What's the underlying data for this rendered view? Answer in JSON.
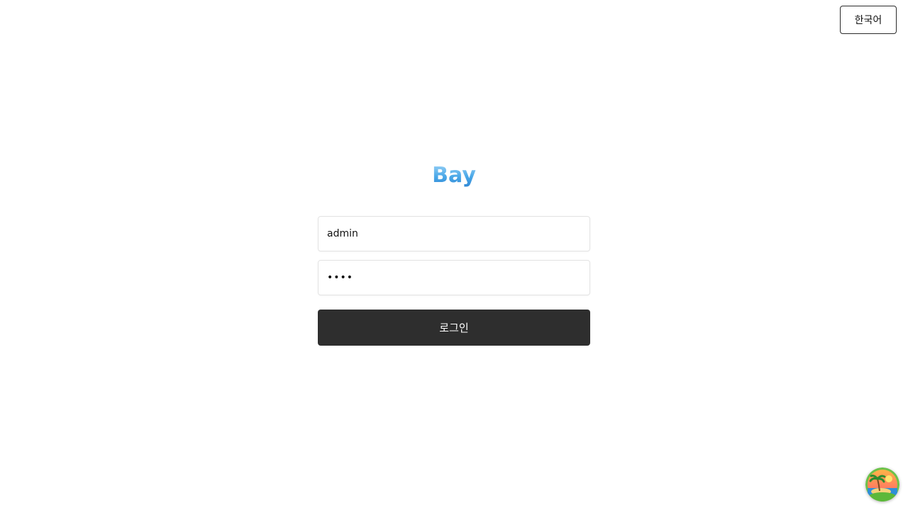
{
  "header": {
    "language_label": "한국어"
  },
  "logo": {
    "text": "Bay",
    "color": "#4aa8e8"
  },
  "login_form": {
    "username_value": "admin",
    "password_value": "1234",
    "submit_label": "로그인"
  },
  "assistant": {
    "icon": "island-avatar-icon"
  }
}
